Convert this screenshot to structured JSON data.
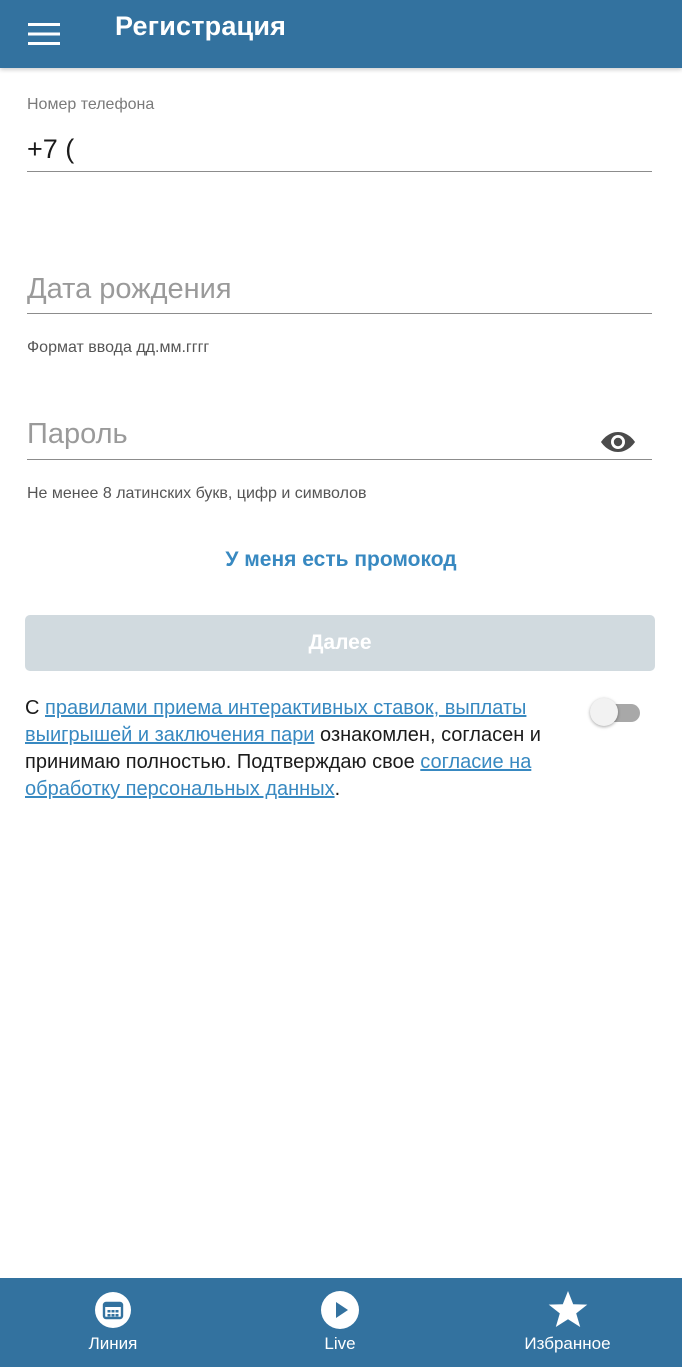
{
  "appbar": {
    "title": "Регистрация",
    "menu_icon": "hamburger-menu-icon",
    "background": "#33729f"
  },
  "form": {
    "phone": {
      "label": "Номер телефона",
      "value": "+7 ("
    },
    "birthdate": {
      "placeholder": "Дата рождения",
      "value": "",
      "helper": "Формат ввода дд.мм.гггг"
    },
    "password": {
      "placeholder": "Пароль",
      "value": "",
      "helper": "Не менее 8 латинских букв, цифр и символов",
      "visibility_icon": "eye-icon"
    },
    "promo_link": "У меня есть промокод",
    "next_button": "Далее"
  },
  "agreement": {
    "prefix": "С ",
    "rules_link": "правилами приема интерактивных ставок, выплаты выигрышей и заключения пари",
    "middle": " ознакомлен, согласен и принимаю полностью. Подтверждаю свое ",
    "consent_link": "согласие на обработку персональных данных",
    "suffix": ".",
    "toggle_on": false
  },
  "bottom_nav": {
    "items": [
      {
        "label": "Линия",
        "icon": "calendar-icon"
      },
      {
        "label": "Live",
        "icon": "play-icon"
      },
      {
        "label": "Избранное",
        "icon": "star-icon"
      }
    ]
  },
  "colors": {
    "primary": "#33729f",
    "link": "#3889c1",
    "button_disabled": "#d1dadf"
  }
}
